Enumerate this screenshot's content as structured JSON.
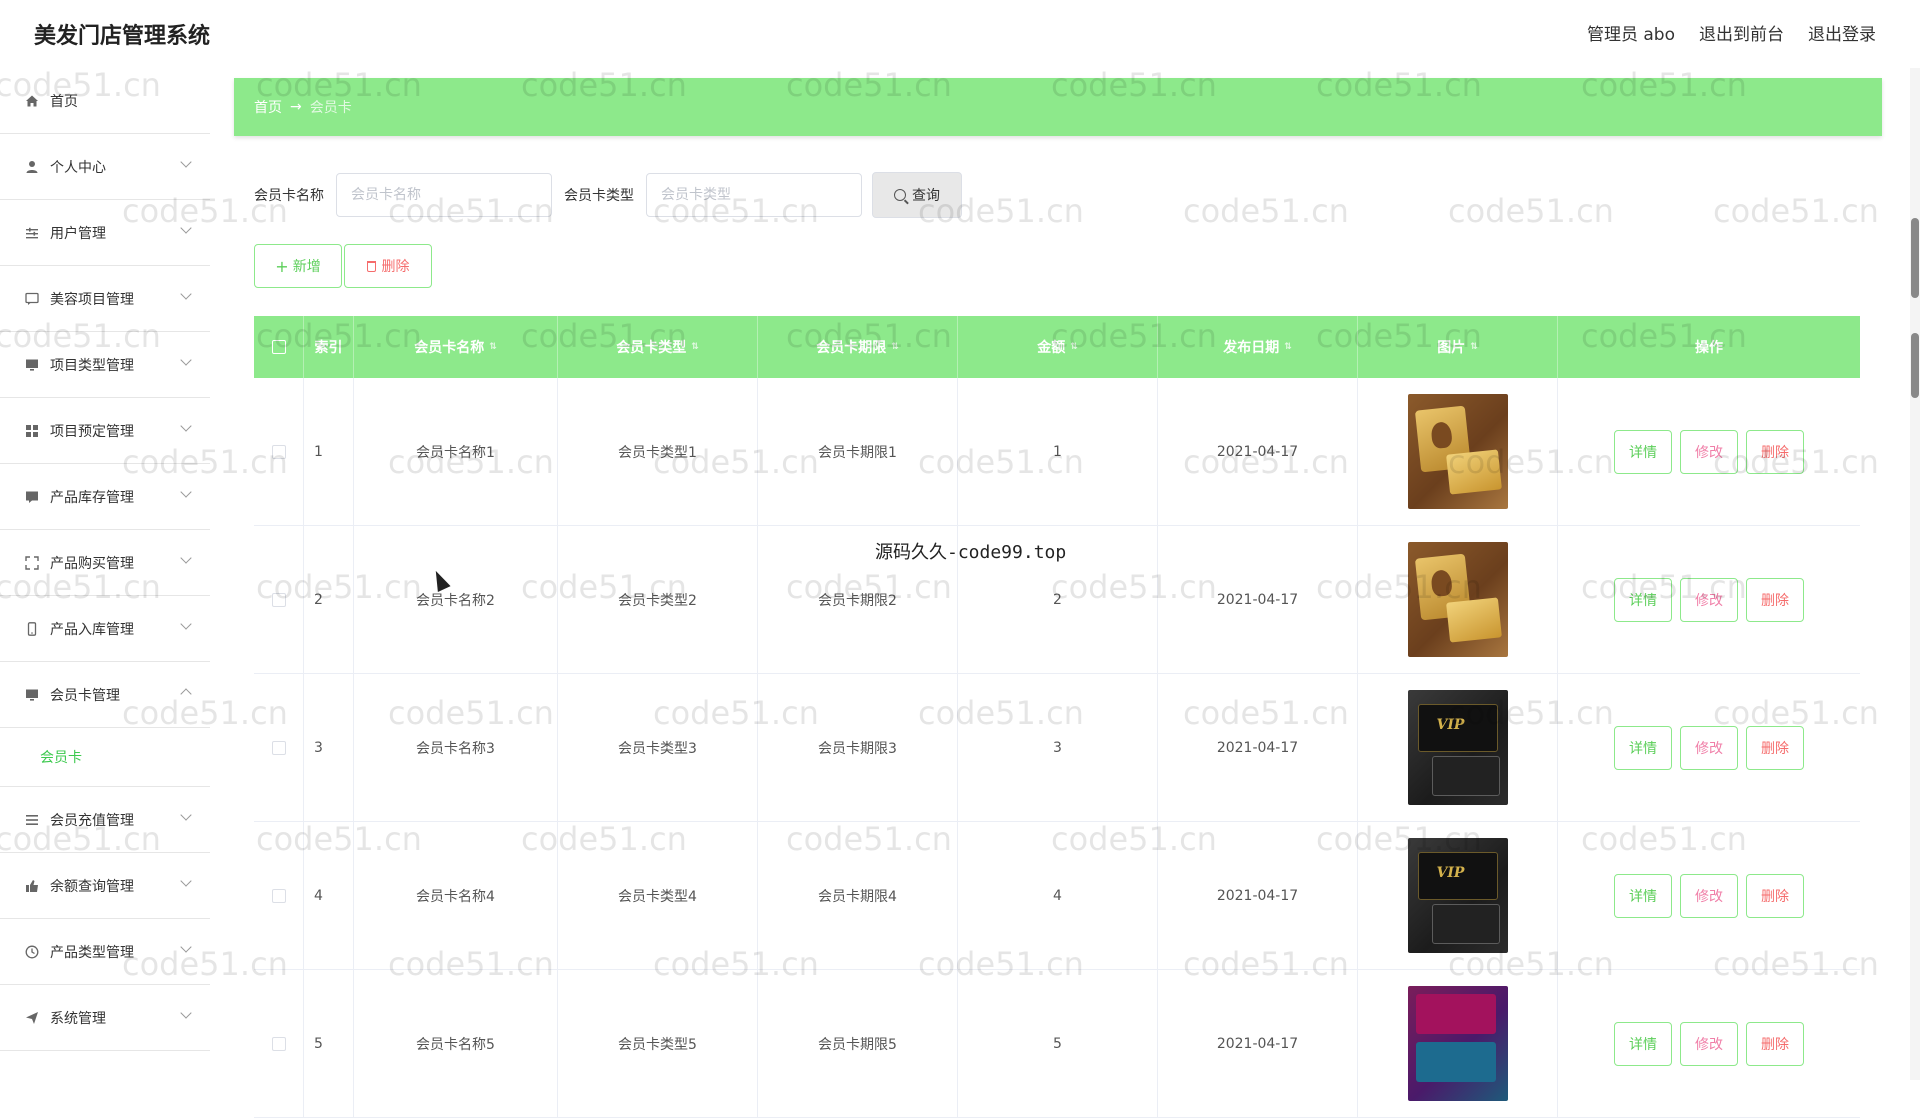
{
  "app": {
    "title": "美发门店管理系统"
  },
  "top_nav": {
    "admin_label": "管理员 abo",
    "front_label": "退出到前台",
    "logout_label": "退出登录"
  },
  "sidebar": {
    "items": [
      {
        "label": "首页",
        "icon": "home-icon"
      },
      {
        "label": "个人中心",
        "icon": "user-icon"
      },
      {
        "label": "用户管理",
        "icon": "sliders-icon"
      },
      {
        "label": "美容项目管理",
        "icon": "chat-icon"
      },
      {
        "label": "项目类型管理",
        "icon": "monitor-icon"
      },
      {
        "label": "项目预定管理",
        "icon": "grid-icon"
      },
      {
        "label": "产品库存管理",
        "icon": "comment-icon"
      },
      {
        "label": "产品购买管理",
        "icon": "fullscreen-icon"
      },
      {
        "label": "产品入库管理",
        "icon": "phone-icon"
      },
      {
        "label": "会员卡管理",
        "icon": "monitor-icon"
      },
      {
        "label": "会员充值管理",
        "icon": "list-icon"
      },
      {
        "label": "余额查询管理",
        "icon": "thumb-icon"
      },
      {
        "label": "产品类型管理",
        "icon": "clock-icon"
      },
      {
        "label": "系统管理",
        "icon": "send-icon"
      }
    ],
    "submenu": {
      "label": "会员卡"
    }
  },
  "breadcrumb": {
    "home": "首页",
    "separator": "→",
    "current": "会员卡"
  },
  "search": {
    "name_label": "会员卡名称",
    "name_placeholder": "会员卡名称",
    "type_label": "会员卡类型",
    "type_placeholder": "会员卡类型",
    "query_label": "查询"
  },
  "actions": {
    "add_label": "新增",
    "delete_label": "删除"
  },
  "table": {
    "headers": [
      "索引",
      "会员卡名称",
      "会员卡类型",
      "会员卡期限",
      "金额",
      "发布日期",
      "图片",
      "操作"
    ],
    "rows": [
      {
        "index": "1",
        "name": "会员卡名称1",
        "type": "会员卡类型1",
        "term": "会员卡期限1",
        "amount": "1",
        "date": "2021-04-17",
        "image": "gold-card"
      },
      {
        "index": "2",
        "name": "会员卡名称2",
        "type": "会员卡类型2",
        "term": "会员卡期限2",
        "amount": "2",
        "date": "2021-04-17",
        "image": "gold-card"
      },
      {
        "index": "3",
        "name": "会员卡名称3",
        "type": "会员卡类型3",
        "term": "会员卡期限3",
        "amount": "3",
        "date": "2021-04-17",
        "image": "black-vip-card"
      },
      {
        "index": "4",
        "name": "会员卡名称4",
        "type": "会员卡类型4",
        "term": "会员卡期限4",
        "amount": "4",
        "date": "2021-04-17",
        "image": "black-vip-card"
      },
      {
        "index": "5",
        "name": "会员卡名称5",
        "type": "会员卡类型5",
        "term": "会员卡期限5",
        "amount": "5",
        "date": "2021-04-17",
        "image": "purple-card"
      }
    ],
    "op_labels": {
      "detail": "详情",
      "edit": "修改",
      "delete": "删除"
    }
  },
  "overlay": {
    "text": "源码久久-code99.top",
    "watermark": "code51.cn"
  },
  "colors": {
    "accent_green": "#8de98b",
    "menu_active": "#3cc94e",
    "danger": "#f56c6c",
    "edit": "#f07fa8"
  }
}
